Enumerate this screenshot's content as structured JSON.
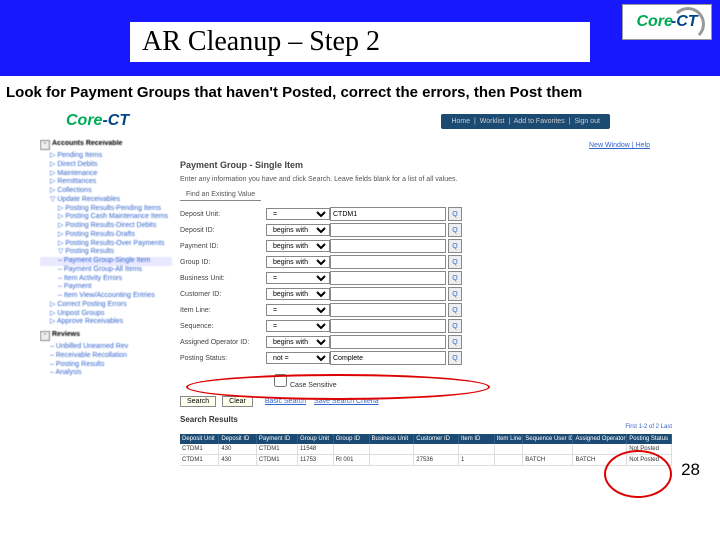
{
  "slide": {
    "title": "AR Cleanup – Step 2",
    "instruction": "Look for Payment Groups that haven't Posted, correct the errors, then Post them",
    "page_number": "28",
    "logo_text": {
      "a": "Core",
      "b": "-CT"
    }
  },
  "header_links": [
    "Home",
    "Worklist",
    "Add to Favorites",
    "Sign out"
  ],
  "new_window": {
    "a": "New Window",
    "b": "Help"
  },
  "nav": {
    "root": "Accounts Receivable",
    "items": [
      "Pending Items",
      "Direct Debits",
      "Maintenance",
      "Remittances",
      "Collections",
      "Update Receivables"
    ],
    "posting": [
      "Posting Results-Pending Items",
      "Posting Cash Maintenance Items",
      "Posting Results-Direct Debits",
      "Posting Results-Drafts",
      "Posting Results-Over Payments",
      "Posting Results"
    ],
    "highlight": "Payment Group-Single Item",
    "posting_sub": [
      "Payment Group-All Items",
      "Item Activity Errors",
      "Payment",
      "Item View/Accounting Entries"
    ],
    "more": [
      "Correct Posting Errors",
      "Unpost Groups",
      "Approve Receivables"
    ],
    "reviews": "Reviews",
    "reviews_sub": [
      "Unbilled Unearned Rev",
      "Receivable Recollation",
      "Posting Results",
      "Analysis"
    ]
  },
  "form": {
    "title": "Payment Group - Single Item",
    "hint": "Enter any information you have and click Search. Leave fields blank for a list of all values.",
    "tab": "Find an Existing Value",
    "rows": [
      {
        "label": "Deposit Unit:",
        "op": "=",
        "val": "CTDM1"
      },
      {
        "label": "Deposit ID:",
        "op": "begins with",
        "val": ""
      },
      {
        "label": "Payment ID:",
        "op": "begins with",
        "val": ""
      },
      {
        "label": "Group ID:",
        "op": "begins with",
        "val": ""
      },
      {
        "label": "Business Unit:",
        "op": "=",
        "val": ""
      },
      {
        "label": "Customer ID:",
        "op": "begins with",
        "val": ""
      },
      {
        "label": "Item Line:",
        "op": "=",
        "val": ""
      },
      {
        "label": "Sequence:",
        "op": "=",
        "val": ""
      },
      {
        "label": "Assigned Operator ID:",
        "op": "begins with",
        "val": ""
      },
      {
        "label": "Posting Status:",
        "op": "not =",
        "val": "Complete"
      }
    ],
    "case_sensitive": "Case Sensitive",
    "buttons": {
      "search": "Search",
      "clear": "Clear",
      "basic": "Basic Search",
      "save": "Save Search Criteria"
    },
    "results_label": "Search Results",
    "results_count": "First 1-2 of 2 Last"
  },
  "grid": {
    "headers": [
      "Deposit Unit",
      "Deposit ID",
      "Payment ID",
      "Group Unit",
      "Group ID",
      "Business Unit",
      "Customer ID",
      "Item ID",
      "Item Line",
      "Sequence User ID",
      "Assigned Operator ID",
      "Posting Status"
    ],
    "rows": [
      [
        "CTDM1",
        "430",
        "CTDM1",
        "11548",
        "",
        "",
        "",
        "",
        "",
        "",
        "",
        "Not Posted"
      ],
      [
        "CTDM1",
        "430",
        "CTDM1",
        "11753",
        "RI 001",
        "",
        "27536",
        "1",
        "",
        "BATCH",
        "BATCH",
        "Not Posted"
      ]
    ]
  }
}
